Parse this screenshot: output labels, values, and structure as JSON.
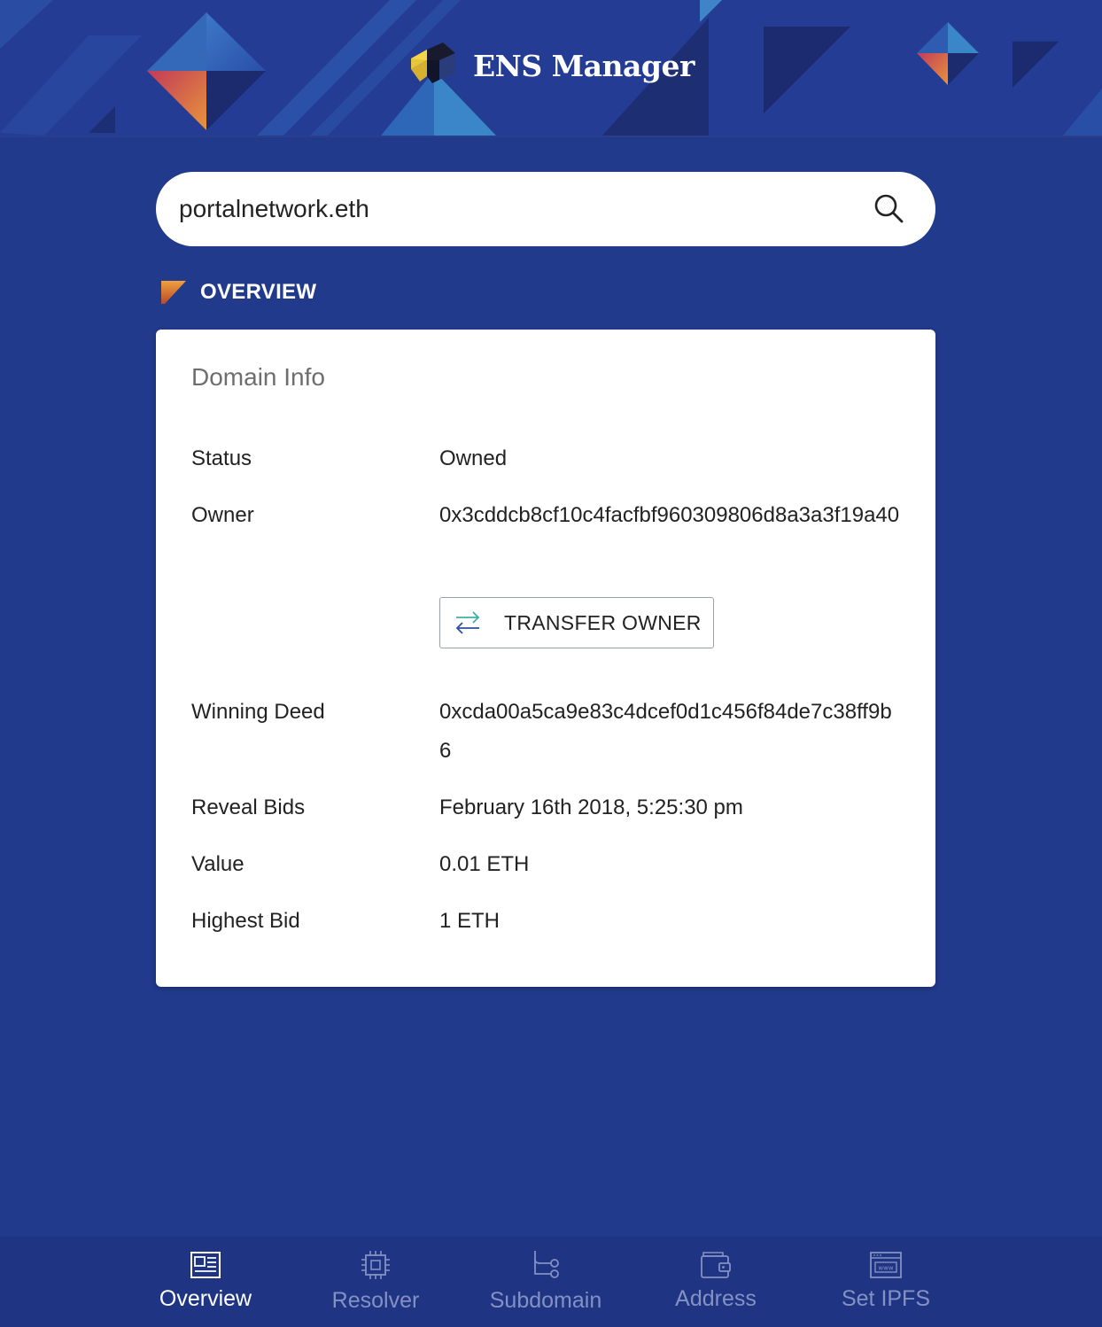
{
  "header": {
    "app_title": "ENS Manager"
  },
  "search": {
    "value": "portalnetwork.eth",
    "icon": "search-icon"
  },
  "section": {
    "label": "OVERVIEW"
  },
  "domain_info": {
    "title": "Domain Info",
    "rows": [
      {
        "label": "Status",
        "value": "Owned"
      },
      {
        "label": "Owner",
        "value": "0x3cddcb8cf10c4facfbf960309806d8a3a3f19a40"
      },
      {
        "label": "Winning Deed",
        "value": "0xcda00a5ca9e83c4dcef0d1c456f84de7c38ff9b6"
      },
      {
        "label": "Reveal Bids",
        "value": "February 16th 2018, 5:25:30 pm"
      },
      {
        "label": "Value",
        "value": "0.01 ETH"
      },
      {
        "label": "Highest Bid",
        "value": "1 ETH"
      }
    ],
    "transfer_button": "TRANSFER OWNER"
  },
  "bottom_nav": {
    "items": [
      {
        "label": "Overview",
        "icon": "newspaper-icon",
        "active": true
      },
      {
        "label": "Resolver",
        "icon": "chip-icon",
        "active": false
      },
      {
        "label": "Subdomain",
        "icon": "branch-icon",
        "active": false
      },
      {
        "label": "Address",
        "icon": "wallet-icon",
        "active": false
      },
      {
        "label": "Set IPFS",
        "icon": "www-browser-icon",
        "active": false
      }
    ]
  },
  "colors": {
    "background": "#223a8c",
    "header": "#243c93",
    "accent_orange": "#e0792a",
    "nav_inactive": "#8391c3",
    "nav_active": "#ffffff"
  }
}
